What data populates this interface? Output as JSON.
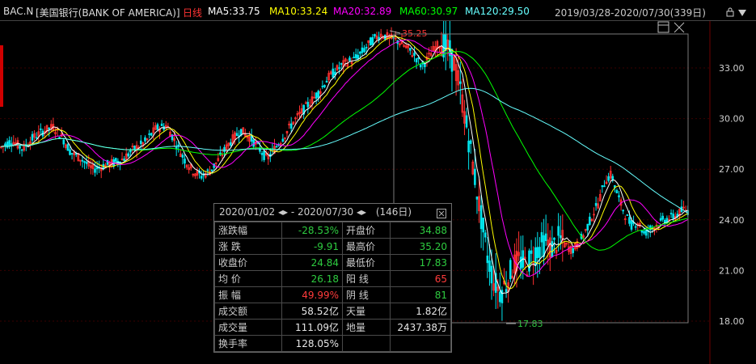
{
  "legend": {
    "symbol": "BAC.N",
    "name": "[美国银行(BANK OF AMERICA)]",
    "period": "日线",
    "ma5": "MA5:33.75",
    "ma10": "MA10:33.24",
    "ma20": "MA20:32.89",
    "ma60": "MA60:30.97",
    "ma120": "MA120:29.50",
    "range": "2019/03/28-2020/07/30(339日)",
    "colors": {
      "ma5": "#ffffff",
      "ma10": "#ffff00",
      "ma20": "#ff00ff",
      "ma60": "#00ff00",
      "ma120": "#66ffff",
      "period": "#ff3333"
    }
  },
  "stats_panel": {
    "range": "2020/01/02 ◂▸ - 2020/07/30 ◂▸",
    "days": "(146日)",
    "close_icon": "close-box-icon",
    "rows": [
      {
        "k": "涨跌幅",
        "v": "-28.53%",
        "vc": "green",
        "k2": "开盘价",
        "v2": "34.88",
        "v2c": "green"
      },
      {
        "k": "涨  跌",
        "v": "-9.91",
        "vc": "green",
        "k2": "最高价",
        "v2": "35.20",
        "v2c": "green"
      },
      {
        "k": "收盘价",
        "v": "24.84",
        "vc": "green",
        "k2": "最低价",
        "v2": "17.83",
        "v2c": "green"
      },
      {
        "k": "均  价",
        "v": "26.18",
        "vc": "green",
        "k2": "阳  线",
        "v2": "65",
        "v2c": "red"
      },
      {
        "k": "振  幅",
        "v": "49.99%",
        "vc": "red",
        "k2": "阴  线",
        "v2": "81",
        "v2c": "green"
      },
      {
        "k": "成交额",
        "v": "58.52亿",
        "vc": "white",
        "k2": "天量",
        "v2": "1.82亿",
        "v2c": "white"
      },
      {
        "k": "成交量",
        "v": "111.09亿",
        "vc": "white",
        "k2": "地量",
        "v2": "2437.38万",
        "v2c": "white"
      },
      {
        "k": "换手率",
        "v": "128.05%",
        "vc": "white",
        "k2": "",
        "v2": "",
        "v2c": "white"
      }
    ]
  },
  "chart_data": {
    "type": "candlestick",
    "yticks": [
      "33.00",
      "30.00",
      "27.00",
      "24.00",
      "21.00",
      "18.00"
    ],
    "ylim": [
      17.3,
      36.2
    ],
    "annotations": [
      {
        "label": "35.25",
        "type": "high"
      },
      {
        "label": "17.83",
        "type": "low"
      }
    ],
    "ma_legend": [
      "MA5",
      "MA10",
      "MA20",
      "MA60",
      "MA120"
    ],
    "ma_colors": [
      "#ffffff",
      "#ffff00",
      "#ff00ff",
      "#00ff00",
      "#66ffff"
    ],
    "price_path": [
      [
        0,
        28.3
      ],
      [
        5,
        28.7
      ],
      [
        10,
        28.2
      ],
      [
        15,
        28.9
      ],
      [
        20,
        29.3
      ],
      [
        24,
        29.5
      ],
      [
        28,
        28.9
      ],
      [
        32,
        28.0
      ],
      [
        37,
        27.6
      ],
      [
        42,
        27.0
      ],
      [
        47,
        27.2
      ],
      [
        52,
        27.4
      ],
      [
        56,
        27.6
      ],
      [
        60,
        28.1
      ],
      [
        66,
        28.6
      ],
      [
        71,
        29.4
      ],
      [
        76,
        29.6
      ],
      [
        80,
        28.6
      ],
      [
        84,
        27.6
      ],
      [
        88,
        26.9
      ],
      [
        92,
        26.6
      ],
      [
        96,
        26.9
      ],
      [
        100,
        27.6
      ],
      [
        105,
        28.6
      ],
      [
        110,
        29.3
      ],
      [
        114,
        28.9
      ],
      [
        118,
        28.3
      ],
      [
        122,
        27.6
      ],
      [
        126,
        28.3
      ],
      [
        130,
        29.0
      ],
      [
        134,
        29.8
      ],
      [
        138,
        30.4
      ],
      [
        142,
        31.0
      ],
      [
        146,
        31.6
      ],
      [
        150,
        32.4
      ],
      [
        154,
        32.9
      ],
      [
        158,
        33.3
      ],
      [
        162,
        33.5
      ],
      [
        166,
        34.0
      ],
      [
        170,
        34.6
      ],
      [
        174,
        35.0
      ],
      [
        178,
        34.8
      ],
      [
        182,
        34.6
      ],
      [
        186,
        34.2
      ],
      [
        190,
        33.7
      ],
      [
        193,
        33.1
      ],
      [
        196,
        33.6
      ],
      [
        199,
        34.2
      ],
      [
        202,
        34.5
      ],
      [
        205,
        34.1
      ],
      [
        208,
        33.2
      ],
      [
        211,
        31.5
      ],
      [
        214,
        29.2
      ],
      [
        217,
        26.8
      ],
      [
        220,
        24.3
      ],
      [
        223,
        21.9
      ],
      [
        226,
        20.4
      ],
      [
        229,
        19.7
      ],
      [
        232,
        20.3
      ],
      [
        235,
        21.3
      ],
      [
        238,
        21.6
      ],
      [
        241,
        21.3
      ],
      [
        244,
        21.9
      ],
      [
        247,
        22.4
      ],
      [
        250,
        22.7
      ],
      [
        253,
        22.3
      ],
      [
        256,
        22.9
      ],
      [
        259,
        22.5
      ],
      [
        262,
        22.2
      ],
      [
        265,
        22.6
      ],
      [
        268,
        23.3
      ],
      [
        271,
        24.2
      ],
      [
        274,
        25.0
      ],
      [
        277,
        26.3
      ],
      [
        280,
        26.7
      ],
      [
        283,
        25.4
      ],
      [
        286,
        24.4
      ],
      [
        289,
        23.7
      ],
      [
        292,
        23.9
      ],
      [
        295,
        23.2
      ],
      [
        298,
        23.5
      ],
      [
        301,
        23.7
      ],
      [
        304,
        24.0
      ],
      [
        307,
        24.1
      ],
      [
        310,
        24.3
      ],
      [
        313,
        24.6
      ],
      [
        316,
        24.5
      ]
    ]
  }
}
